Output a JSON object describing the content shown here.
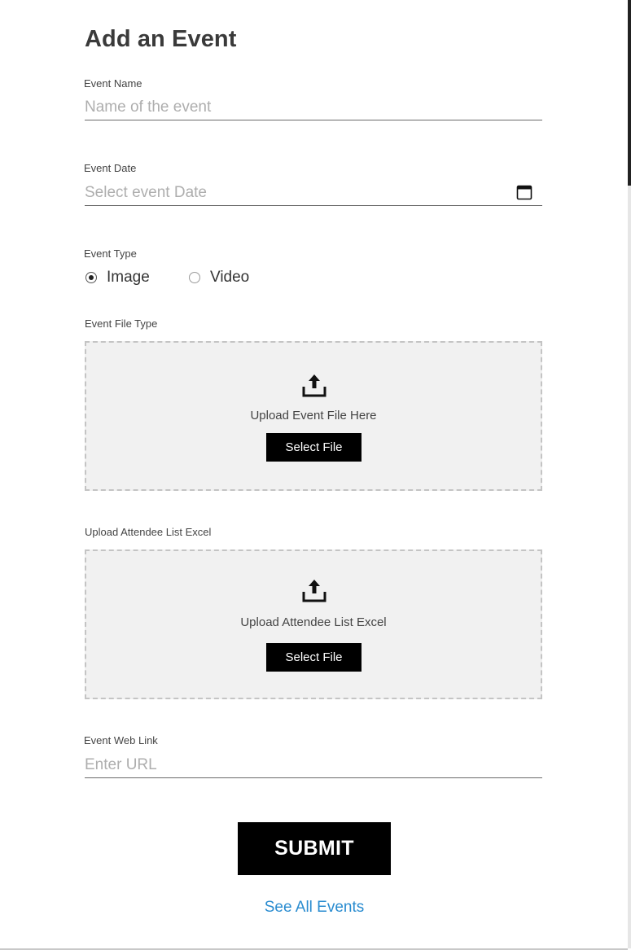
{
  "form": {
    "title": "Add an Event",
    "event_name": {
      "label": "Event Name",
      "placeholder": "Name of the event",
      "value": ""
    },
    "event_date": {
      "label": "Event Date",
      "placeholder": "Select event Date",
      "value": "",
      "icon": "calendar-icon"
    },
    "event_type": {
      "label": "Event Type",
      "options": [
        {
          "label": "Image",
          "selected": true
        },
        {
          "label": "Video",
          "selected": false
        }
      ]
    },
    "event_file": {
      "label": "Event File Type",
      "drop_text": "Upload Event File Here",
      "button_label": "Select File",
      "icon": "upload-icon"
    },
    "attendee_list": {
      "label": "Upload Attendee List Excel",
      "drop_text": "Upload Attendee List Excel",
      "button_label": "Select File",
      "icon": "upload-icon"
    },
    "web_link": {
      "label": "Event Web Link",
      "placeholder": "Enter URL",
      "value": ""
    },
    "submit_label": "SUBMIT",
    "see_all_label": "See All Events"
  },
  "colors": {
    "link": "#2a8cd0",
    "button_bg": "#000000",
    "dropzone_bg": "#f1f1f1"
  }
}
